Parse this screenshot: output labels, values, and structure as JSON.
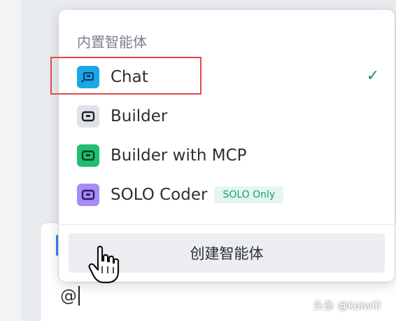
{
  "dropdown": {
    "section_title": "内置智能体",
    "items": [
      {
        "label": "Chat",
        "icon": "chat-bot-icon",
        "icon_color": "#1aa7e8",
        "selected": true
      },
      {
        "label": "Builder",
        "icon": "builder-bot-icon",
        "icon_color": "#dfe3e8"
      },
      {
        "label": "Builder with MCP",
        "icon": "builder-mcp-bot-icon",
        "icon_color": "#1fbf6e"
      },
      {
        "label": "SOLO Coder",
        "icon": "solo-coder-bot-icon",
        "icon_color": "#a78bfa",
        "badge": "SOLO Only"
      }
    ],
    "create_button_label": "创建智能体"
  },
  "input": {
    "value": "@"
  },
  "watermark": "头条 @kaiwill",
  "colors": {
    "check": "#0f8a7a",
    "highlight_border": "#e24a4a",
    "badge_text": "#12a27b"
  }
}
